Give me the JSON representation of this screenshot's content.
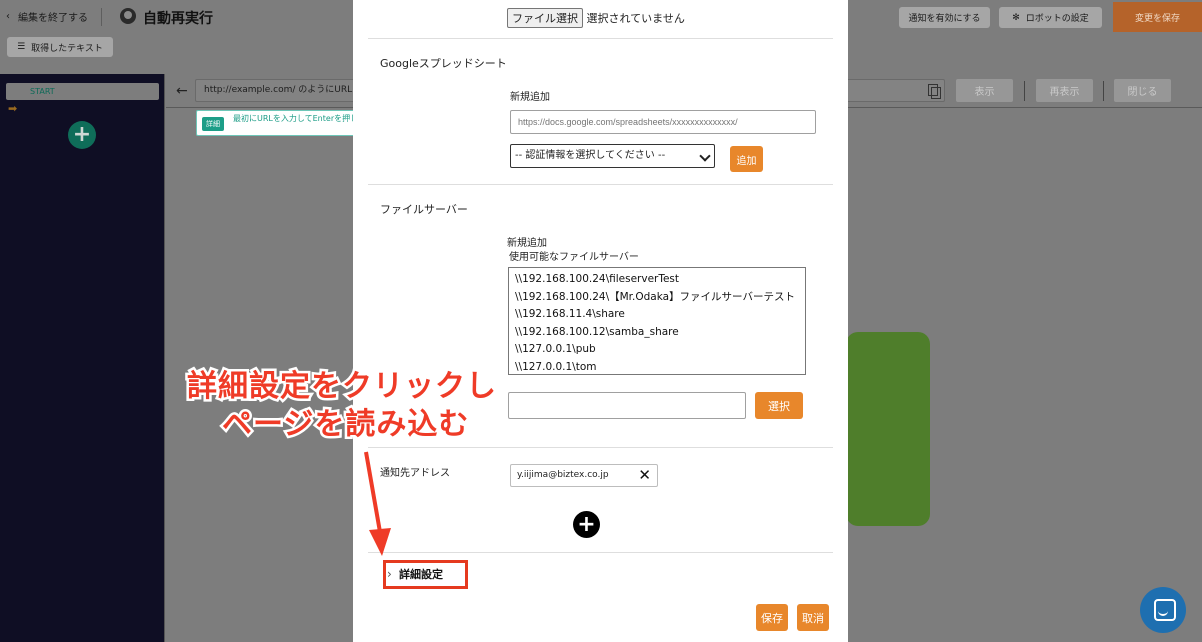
{
  "topbar": {
    "back_label": "編集を終了する",
    "back_icon": "‹",
    "robot_title": "自動再実行",
    "notify_label": "通知を有効にする",
    "settings_label": "ロボットの設定",
    "settings_icon": "✻",
    "save_label": "変更を保存",
    "captured_text_label": "取得したテキスト",
    "captured_text_icon": "☰"
  },
  "sidebar": {
    "start_label": "START",
    "arrow_icon": "➡",
    "add_icon": "+"
  },
  "browser": {
    "back_icon": "←",
    "url_placeholder": "http://example.com/ のようにURL",
    "show_label": "表示",
    "reload_label": "再表示",
    "close_label": "閉じる",
    "tooltip_badge": "詳細",
    "tooltip_text": "最初にURLを入力してEnterを押して下さい。"
  },
  "modal": {
    "file_button_label": "ファイル選択",
    "file_status": "選択されていません",
    "google_section_title": "Googleスプレッドシート",
    "google_new_label": "新規追加",
    "google_url_placeholder": "https://docs.google.com/spreadsheets/xxxxxxxxxxxxxx/",
    "auth_select_value": "-- 認証情報を選択してください --",
    "add_button_label": "追加",
    "fileserver_section_title": "ファイルサーバー",
    "fileserver_new_label": "新規追加",
    "fileserver_available_label": "使用可能なファイルサーバー",
    "fileservers": [
      "\\\\192.168.100.24\\fileserverTest",
      "\\\\192.168.100.24\\【Mr.Odaka】ファイルサーバーテスト",
      "\\\\192.168.11.4\\share",
      "\\\\192.168.100.12\\samba_share",
      "\\\\127.0.0.1\\pub",
      "\\\\127.0.0.1\\tom"
    ],
    "select_button_label": "選択",
    "notify_address_label": "通知先アドレス",
    "email_chip": "y.iijima@biztex.co.jp",
    "chip_close_icon": "✕",
    "add_email_icon": "+",
    "advanced_label": "詳細設定",
    "save_label": "保存",
    "cancel_label": "取消"
  },
  "annotation": {
    "line1": "詳細設定をクリックし",
    "line2": "ページを読み込む",
    "color": "#ef3b27"
  },
  "colors": {
    "accent_orange": "#e8872b",
    "sidebar_bg": "#0f0e24",
    "teal": "#1d9e88"
  }
}
